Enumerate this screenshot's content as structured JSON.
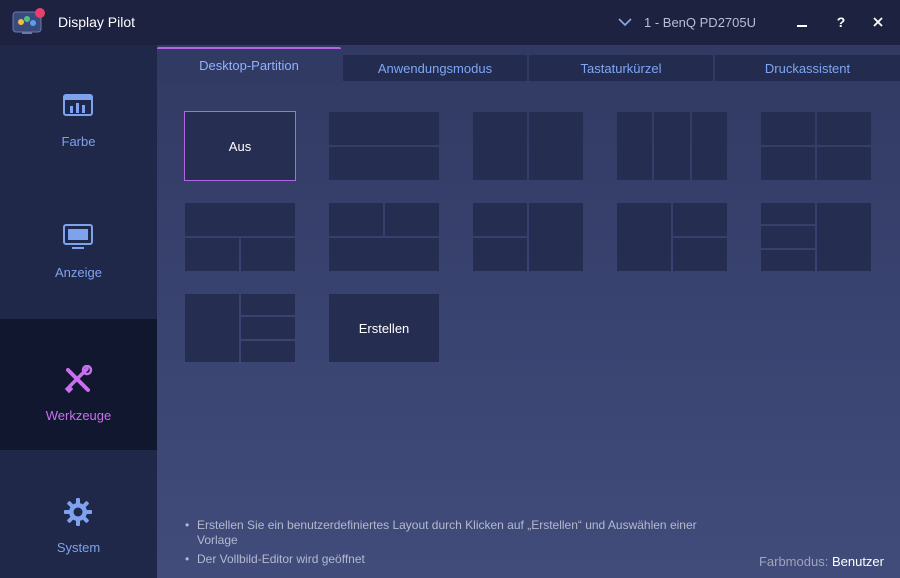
{
  "app": {
    "title": "Display Pilot"
  },
  "monitor": {
    "name": "1 - BenQ PD2705U"
  },
  "window_controls": {
    "minimize": "—",
    "help": "?",
    "close": "✕"
  },
  "sidebar": {
    "items": [
      {
        "label": "Farbe",
        "icon": "chart-icon",
        "active": false
      },
      {
        "label": "Anzeige",
        "icon": "monitor-icon",
        "active": false
      },
      {
        "label": "Werkzeuge",
        "icon": "tools-icon",
        "active": true
      },
      {
        "label": "System",
        "icon": "gear-icon",
        "active": false
      }
    ]
  },
  "tabs": [
    {
      "label": "Desktop-Partition",
      "active": true
    },
    {
      "label": "Anwendungsmodus",
      "active": false
    },
    {
      "label": "Tastaturkürzel",
      "active": false
    },
    {
      "label": "Druckassistent",
      "active": false
    }
  ],
  "layouts": {
    "off_label": "Aus",
    "create_label": "Erstellen"
  },
  "hints": [
    "Erstellen Sie ein benutzerdefiniertes Layout durch Klicken auf „Erstellen“ und Auswählen einer Vorlage",
    "Der Vollbild-Editor wird geöffnet"
  ],
  "status": {
    "color_mode_label": "Farbmodus:",
    "color_mode_value": "Benutzer"
  },
  "colors": {
    "accent": "#b266e6",
    "tab_text": "#7fa6f4",
    "sidebar_text": "#7fa2ee",
    "active_sidebar_text": "#c96ff0"
  }
}
